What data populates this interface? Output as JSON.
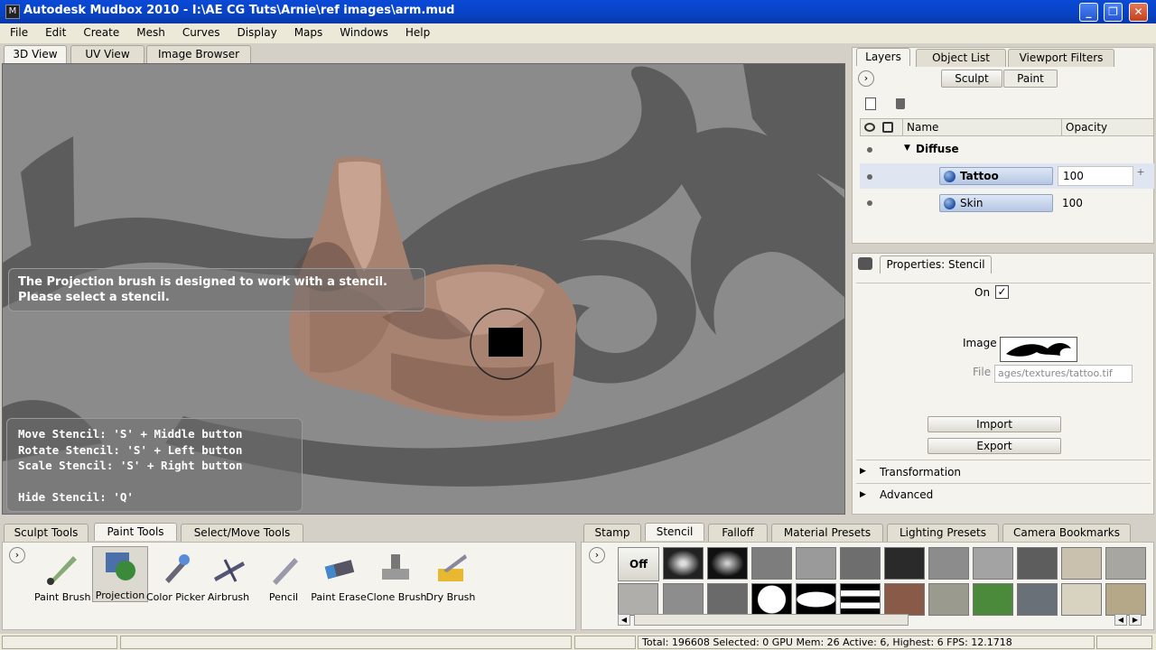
{
  "window": {
    "title": "Autodesk Mudbox 2010 - I:\\AE CG Tuts\\Arnie\\ref images\\arm.mud",
    "minimize": "_",
    "restore": "❐",
    "close": "✕"
  },
  "menu": [
    "File",
    "Edit",
    "Create",
    "Mesh",
    "Curves",
    "Display",
    "Maps",
    "Windows",
    "Help"
  ],
  "view_tabs": [
    "3D View",
    "UV View",
    "Image Browser"
  ],
  "viewport": {
    "message": "The Projection brush is designed to work with a stencil. Please select a stencil.",
    "hints": [
      "Move Stencil: 'S' + Middle button",
      "Rotate Stencil: 'S' + Left button",
      "Scale Stencil: 'S' + Right button",
      "",
      "Hide Stencil: 'Q'"
    ]
  },
  "right_tabs": [
    "Layers",
    "Object List",
    "Viewport Filters"
  ],
  "layer_modes": [
    "Sculpt",
    "Paint"
  ],
  "layers_table": {
    "headers": [
      "Name",
      "Opacity"
    ],
    "group": "Diffuse",
    "rows": [
      {
        "name": "Tattoo",
        "opacity": "100"
      },
      {
        "name": "Skin",
        "opacity": "100"
      }
    ]
  },
  "properties": {
    "title": "Properties: Stencil",
    "on_label": "On",
    "on_check": "✓",
    "image_label": "Image",
    "file_label": "File",
    "file_value": "ages/textures/tattoo.tif",
    "import": "Import",
    "export": "Export",
    "sections": [
      "Transformation",
      "Advanced"
    ]
  },
  "tool_tabs": [
    "Sculpt Tools",
    "Paint Tools",
    "Select/Move Tools"
  ],
  "paint_tools": [
    "Paint Brush",
    "Projection",
    "Color Picker",
    "Airbrush",
    "Pencil",
    "Paint Erase",
    "Clone Brush",
    "Dry Brush"
  ],
  "stamp_tabs": [
    "Stamp",
    "Stencil",
    "Falloff",
    "Material Presets",
    "Lighting Presets",
    "Camera Bookmarks"
  ],
  "stencil_off": "Off",
  "status": "Total: 196608  Selected: 0 GPU Mem: 26  Active: 6, Highest: 6  FPS: 12.1718",
  "colors": {
    "title_blue": "#0842c4",
    "viewport_gray": "#8b8b8b",
    "skin": "#b08a78",
    "tattoo_dark": "#444444"
  }
}
